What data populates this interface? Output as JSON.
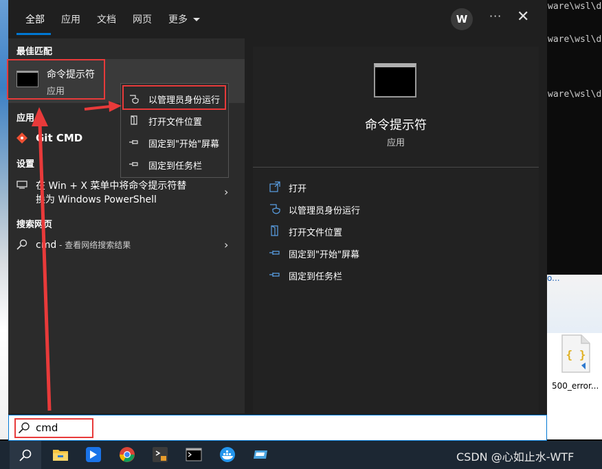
{
  "tabs": [
    {
      "label": "全部"
    },
    {
      "label": "应用"
    },
    {
      "label": "文档"
    },
    {
      "label": "网页"
    },
    {
      "label": "更多"
    }
  ],
  "header": {
    "avatar_initial": "W",
    "more_label": "···",
    "close_label": "✕"
  },
  "sections": {
    "best_match": "最佳匹配",
    "apps": "应用",
    "settings": "设置",
    "web": "搜索网页"
  },
  "best_match": {
    "title": "命令提示符",
    "subtitle": "应用"
  },
  "apps_item": {
    "label": "Git CMD"
  },
  "settings_item": {
    "line1": "在 Win + X 菜单中将命令提示符替",
    "line2": "换为 Windows PowerShell"
  },
  "web_item": {
    "query": "cmd",
    "suffix": " - 查看网络搜索结果"
  },
  "context_menu": {
    "items": [
      {
        "label": "以管理员身份运行",
        "icon": "shield-icon"
      },
      {
        "label": "打开文件位置",
        "icon": "folder-icon"
      },
      {
        "label": "固定到\"开始\"屏幕",
        "icon": "pin-icon"
      },
      {
        "label": "固定到任务栏",
        "icon": "pin-icon"
      }
    ]
  },
  "detail": {
    "title": "命令提示符",
    "subtitle": "应用",
    "actions": [
      {
        "label": "打开",
        "icon": "open-icon"
      },
      {
        "label": "以管理员身份运行",
        "icon": "shield-icon"
      },
      {
        "label": "打开文件位置",
        "icon": "folder-icon"
      },
      {
        "label": "固定到\"开始\"屏幕",
        "icon": "pin-icon"
      },
      {
        "label": "固定到任务栏",
        "icon": "pin-icon"
      }
    ]
  },
  "search": {
    "value": "cmd"
  },
  "background": {
    "terminal_lines": [
      "ware\\wsl\\d",
      "ware\\wsl\\d",
      "ware\\wsl\\d"
    ],
    "vs_dots": "o...",
    "desktop_icon_label": "500_error..."
  },
  "taskbar": {
    "icons": [
      "search-icon",
      "file-explorer-icon",
      "feishu-icon",
      "chrome-icon",
      "sublime-icon",
      "terminal-icon",
      "docker-icon",
      "vpn-icon"
    ]
  },
  "watermark": "CSDN @心如止水-WTF",
  "colors": {
    "accent": "#0078d4",
    "annotation": "#e83a3a",
    "menu_bg": "#1f1f1f"
  }
}
